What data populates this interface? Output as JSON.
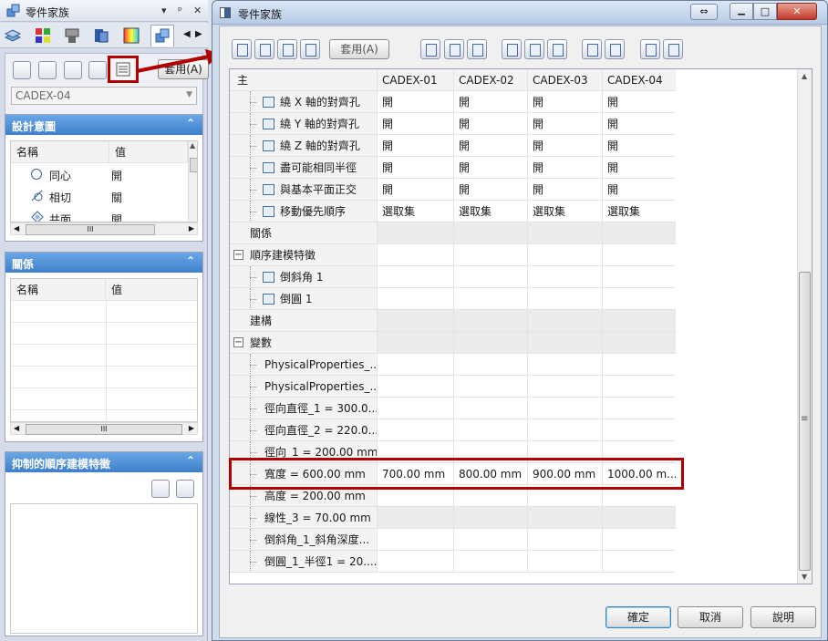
{
  "left_panel": {
    "title": "零件家族",
    "title_controls": [
      "▾",
      "ᵖ",
      "✕"
    ],
    "apply_label": "套用(A)",
    "family_select": "CADEX-04",
    "design_intent": {
      "title": "設計意圖",
      "col_name": "名稱",
      "col_value": "值",
      "rows": [
        {
          "name": "同心",
          "value": "開"
        },
        {
          "name": "相切",
          "value": "關"
        },
        {
          "name": "共面",
          "value": "開"
        }
      ],
      "scroll_mark": "III"
    },
    "relations": {
      "title": "關係",
      "col_name": "名稱",
      "col_value": "值",
      "scroll_mark": "III"
    },
    "suppressed": {
      "title": "抑制的順序建模特徵"
    }
  },
  "dialog": {
    "title": "零件家族",
    "apply_label": "套用(A)",
    "columns": [
      "主",
      "CADEX-01",
      "CADEX-02",
      "CADEX-03",
      "CADEX-04"
    ],
    "rows": [
      {
        "label": "繞 X 軸的對齊孔",
        "values": [
          "開",
          "開",
          "開",
          "開"
        ]
      },
      {
        "label": "繞 Y 軸的對齊孔",
        "values": [
          "開",
          "開",
          "開",
          "開"
        ]
      },
      {
        "label": "繞 Z 軸的對齊孔",
        "values": [
          "開",
          "開",
          "開",
          "開"
        ]
      },
      {
        "label": "盡可能相同半徑",
        "values": [
          "開",
          "開",
          "開",
          "開"
        ]
      },
      {
        "label": "與基本平面正交",
        "values": [
          "開",
          "開",
          "開",
          "開"
        ]
      },
      {
        "label": "移動優先順序",
        "values": [
          "選取集",
          "選取集",
          "選取集",
          "選取集"
        ]
      },
      {
        "label": "關係",
        "values": [
          "",
          "",
          "",
          ""
        ]
      },
      {
        "label": "順序建模特徵",
        "values": [
          "",
          "",
          "",
          ""
        ]
      },
      {
        "label": "倒斜角 1",
        "values": [
          "",
          "",
          "",
          ""
        ]
      },
      {
        "label": "倒圓 1",
        "values": [
          "",
          "",
          "",
          ""
        ]
      },
      {
        "label": "建構",
        "values": [
          "",
          "",
          "",
          ""
        ]
      },
      {
        "label": "變數",
        "values": [
          "",
          "",
          "",
          ""
        ]
      },
      {
        "label": "PhysicalProperties_...",
        "values": [
          "",
          "",
          "",
          ""
        ]
      },
      {
        "label": "PhysicalProperties_...",
        "values": [
          "",
          "",
          "",
          ""
        ]
      },
      {
        "label": "徑向直徑_1 = 300.0...",
        "values": [
          "",
          "",
          "",
          ""
        ]
      },
      {
        "label": "徑向直徑_2 = 220.0...",
        "values": [
          "",
          "",
          "",
          ""
        ]
      },
      {
        "label": "徑向_1 = 200.00 mm",
        "values": [
          "",
          "",
          "",
          ""
        ]
      },
      {
        "label": "寬度 = 600.00 mm",
        "values": [
          "700.00 mm",
          "800.00 mm",
          "900.00 mm",
          "1000.00 m..."
        ]
      },
      {
        "label": "高度 = 200.00 mm",
        "values": [
          "",
          "",
          "",
          ""
        ]
      },
      {
        "label": "線性_3 = 70.00 mm",
        "values": [
          "",
          "",
          "",
          ""
        ]
      },
      {
        "label": "倒斜角_1_斜角深度...",
        "values": [
          "",
          "",
          "",
          ""
        ]
      },
      {
        "label": "倒圓_1_半徑1 = 20....",
        "values": [
          "",
          "",
          "",
          ""
        ]
      }
    ],
    "expand_glyph": "−",
    "scroll_grip": "≡",
    "buttons": {
      "ok": "確定",
      "cancel": "取消",
      "help": "說明"
    },
    "window_controls": {
      "restore": "⇔",
      "minimize": "▁",
      "maximize": "□",
      "close": "✕"
    }
  },
  "colors": {
    "highlight": "#b00000",
    "section_header": "#4a8ad4"
  }
}
